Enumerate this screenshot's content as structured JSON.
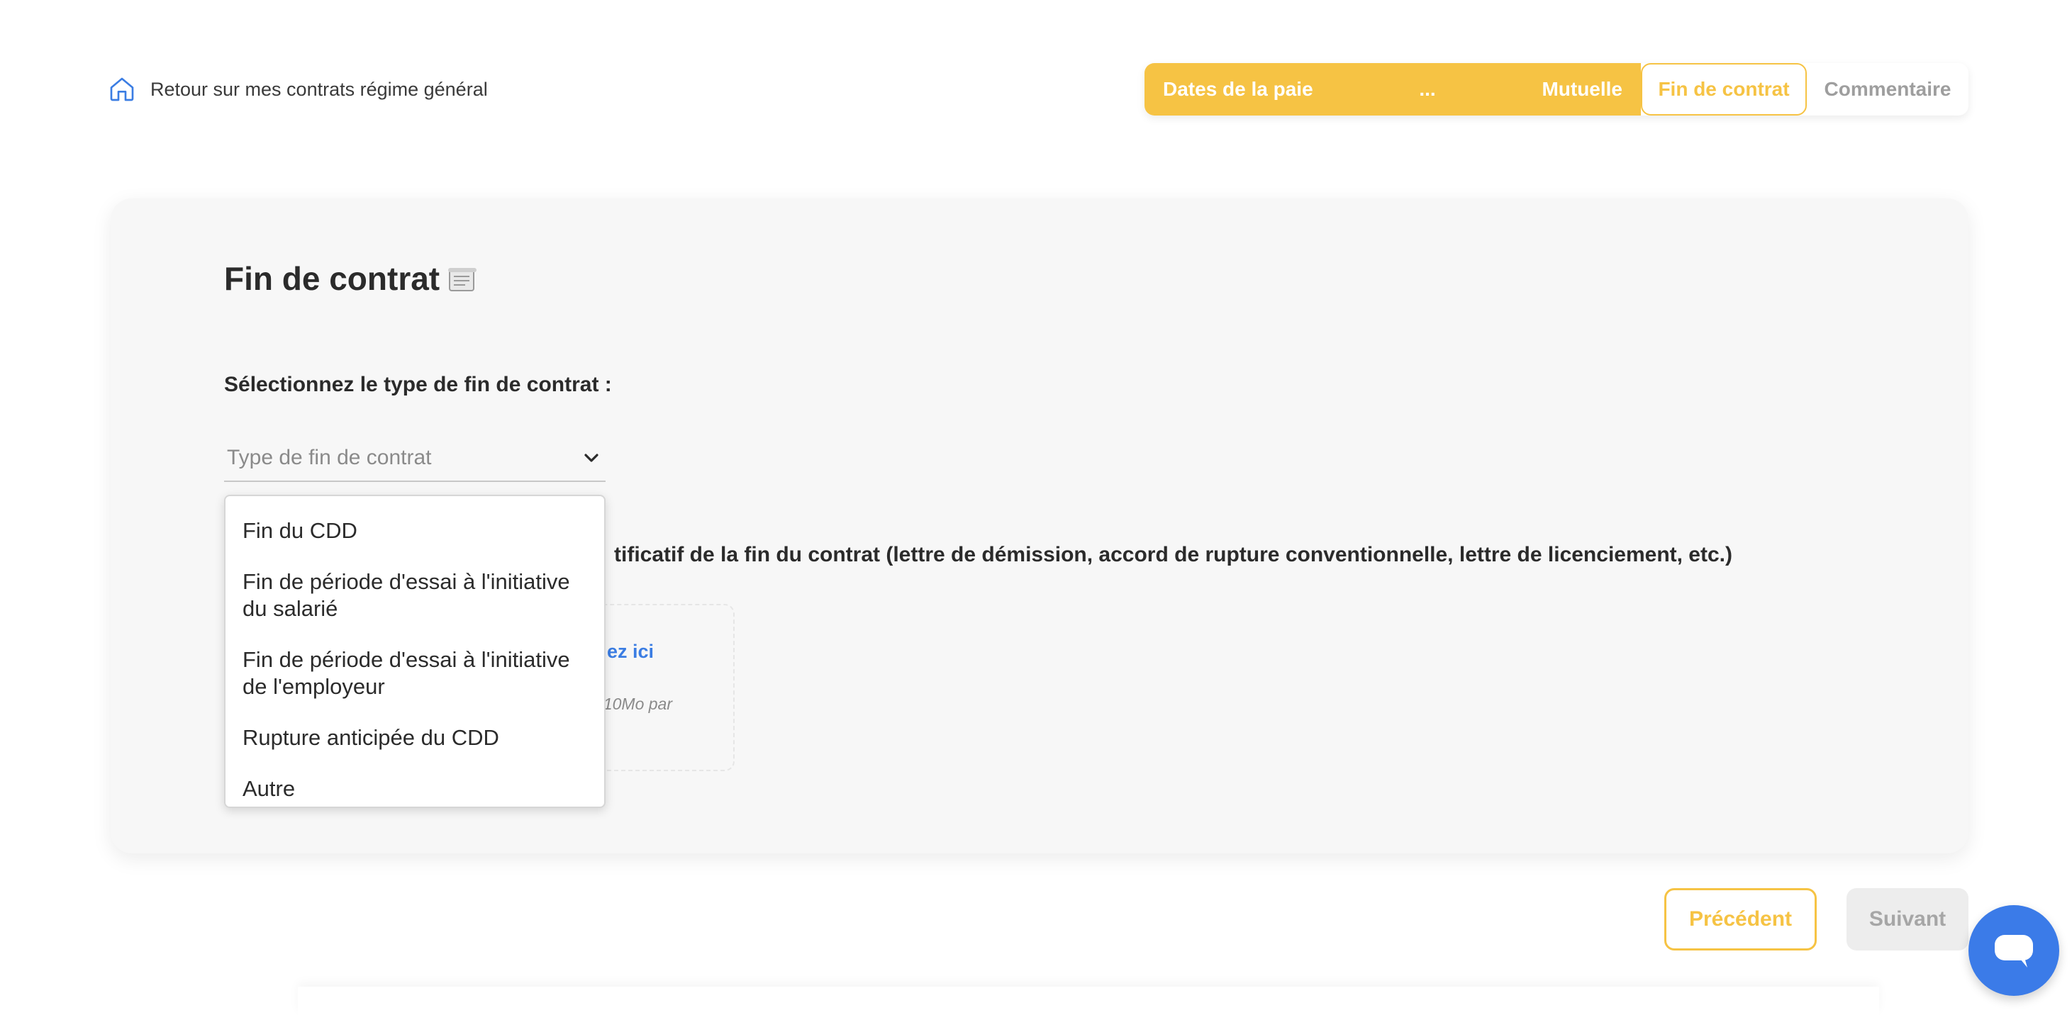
{
  "header": {
    "back_label": "Retour sur mes contrats régime général"
  },
  "stepper": {
    "steps_done": [
      "Dates de la paie",
      "...",
      "Mutuelle"
    ],
    "current": "Fin de contrat",
    "next": "Commentaire"
  },
  "card": {
    "title": "Fin de contrat",
    "select_label": "Sélectionnez le type de fin de contrat :",
    "select_placeholder": "Type de fin de contrat",
    "justif_label_visible": "tificatif de la fin du contrat (lettre de démission, accord de rupture conventionnelle, lettre de licenciement, etc.)",
    "dropzone_link_visible": "ez ici",
    "dropzone_hint_visible": "10Mo par"
  },
  "dropdown": {
    "options": [
      "Fin du CDD",
      "Fin de période d'essai à l'initiative du salarié",
      "Fin de période d'essai à l'initiative de l'employeur",
      "Rupture anticipée du CDD",
      "Autre"
    ]
  },
  "footer": {
    "prev_label": "Précédent",
    "next_label": "Suivant"
  },
  "colors": {
    "accent": "#f6c344",
    "link": "#3b7de3",
    "chat": "#3b7be8"
  }
}
